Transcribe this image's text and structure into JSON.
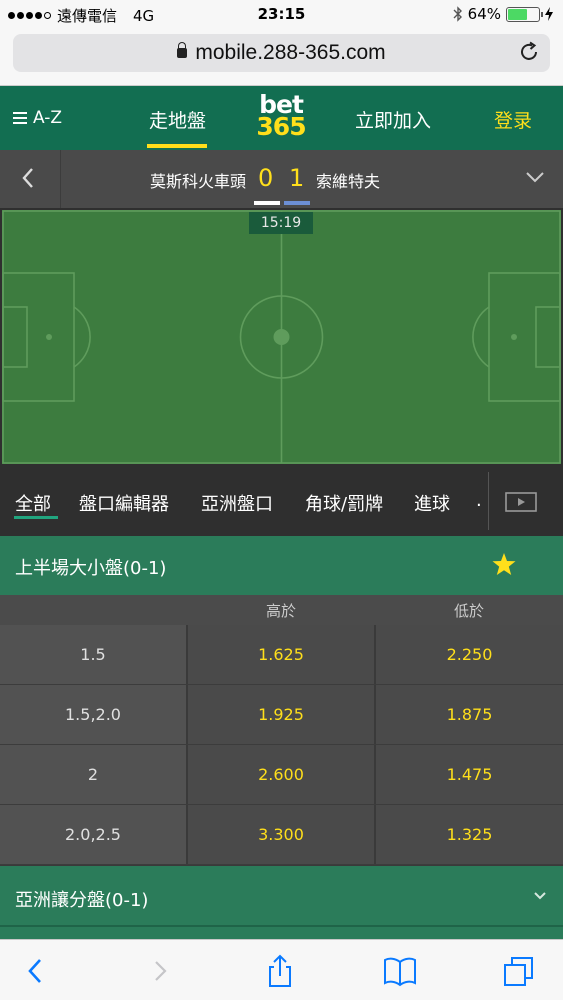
{
  "status_bar": {
    "carrier": "遠傳電信",
    "network": "4G",
    "time": "23:15",
    "battery": "64%",
    "battery_level": 0.64,
    "signal_bars": 4
  },
  "browser": {
    "url": "mobile.288-365.com"
  },
  "top_nav": {
    "menu_label": "A-Z",
    "in_play_label": "走地盤",
    "logo_top": "bet",
    "logo_bottom": "365",
    "join_label": "立即加入",
    "login_label": "登录"
  },
  "match": {
    "home_team": "莫斯科火車頭",
    "away_team": "索維特夫",
    "home_score": "0",
    "away_score": "1",
    "clock": "15:19"
  },
  "tabs": [
    {
      "label": "全部",
      "active": true
    },
    {
      "label": "盤口編輯器",
      "active": false
    },
    {
      "label": "亞洲盤口",
      "active": false
    },
    {
      "label": "角球/罰牌",
      "active": false
    },
    {
      "label": "進球",
      "active": false
    }
  ],
  "tabs_more": ".",
  "market": {
    "title": "上半場大小盤(0-1)",
    "col_over": "高於",
    "col_under": "低於",
    "rows": [
      {
        "line": "1.5",
        "over": "1.625",
        "under": "2.250"
      },
      {
        "line": "1.5,2.0",
        "over": "1.925",
        "under": "1.875"
      },
      {
        "line": "2",
        "over": "2.600",
        "under": "1.475"
      },
      {
        "line": "2.0,2.5",
        "over": "3.300",
        "under": "1.325"
      }
    ]
  },
  "market2": {
    "title": "亞洲讓分盤(0-1)"
  },
  "colors": {
    "brand_green": "#126e51",
    "accent_yellow": "#ffdf1b",
    "market_green": "#2b7c5a",
    "pitch_green": "#3d7c3f",
    "away_kit": "#6c8fd4"
  }
}
